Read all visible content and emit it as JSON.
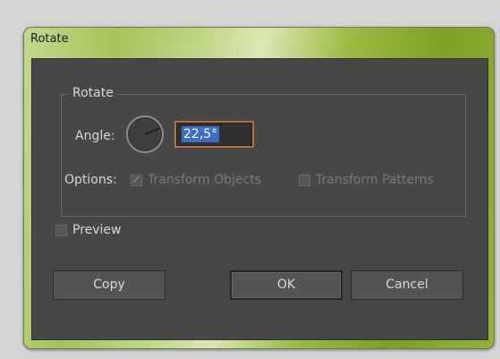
{
  "window": {
    "title": "Rotate"
  },
  "group": {
    "legend": "Rotate"
  },
  "angle": {
    "label": "Angle:",
    "value": "22,5°"
  },
  "options": {
    "label": "Options:",
    "transform_objects": {
      "label": "Transform Objects",
      "checked": true
    },
    "transform_patterns": {
      "label": "Transform Patterns",
      "checked": false
    }
  },
  "preview": {
    "label": "Preview",
    "checked": false
  },
  "buttons": {
    "copy": "Copy",
    "ok": "OK",
    "cancel": "Cancel"
  },
  "colors": {
    "title_bar": "#a6c257",
    "client": "#474747",
    "focus_ring": "#b5703e",
    "selection": "#3b6ec7"
  }
}
